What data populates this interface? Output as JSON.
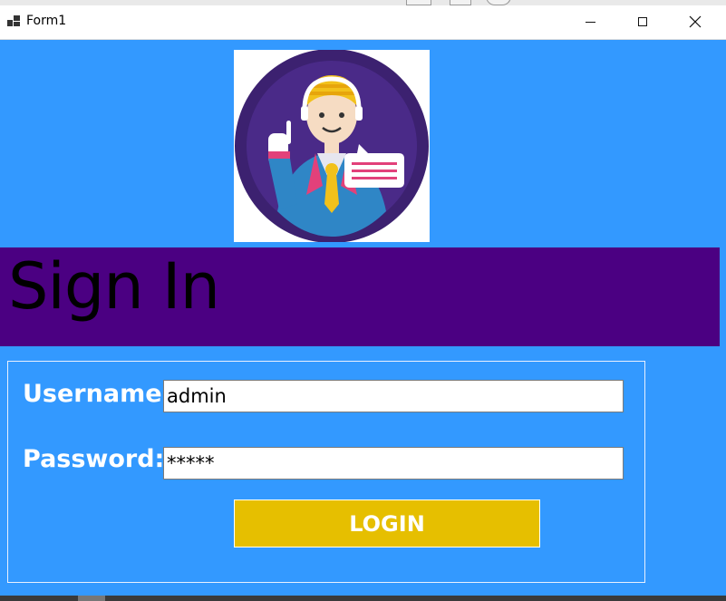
{
  "window": {
    "title": "Form1",
    "controls": {
      "minimize": "minimize",
      "maximize": "maximize",
      "close": "✕"
    }
  },
  "header": {
    "title": "Sign In"
  },
  "form": {
    "username_label": "Username:",
    "username_value": "admin",
    "password_label": "Password:",
    "password_value": "*****",
    "login_label": "LOGIN"
  },
  "colors": {
    "background": "#3399ff",
    "header_band": "#4b0082",
    "login_button": "#e6bf00"
  },
  "icons": {
    "app": "windows-form-icon",
    "avatar": "support-agent-avatar-icon"
  }
}
